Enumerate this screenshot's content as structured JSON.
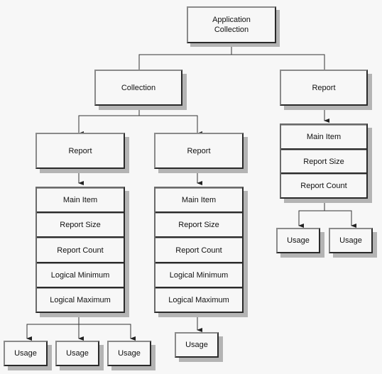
{
  "diagram": {
    "root": {
      "label": "Application\nCollection"
    },
    "collection": {
      "label": "Collection"
    },
    "report_left": {
      "label": "Report"
    },
    "report_mid": {
      "label": "Report"
    },
    "report_right": {
      "label": "Report"
    },
    "stack_left": [
      "Main Item",
      "Report Size",
      "Report Count",
      "Logical Minimum",
      "Logical Maximum"
    ],
    "stack_mid": [
      "Main Item",
      "Report Size",
      "Report Count",
      "Logical Minimum",
      "Logical Maximum"
    ],
    "stack_right": [
      "Main Item",
      "Report Size",
      "Report Count"
    ],
    "usages_left": [
      "Usage",
      "Usage",
      "Usage"
    ],
    "usages_mid": [
      "Usage"
    ],
    "usages_right": [
      "Usage",
      "Usage"
    ]
  }
}
